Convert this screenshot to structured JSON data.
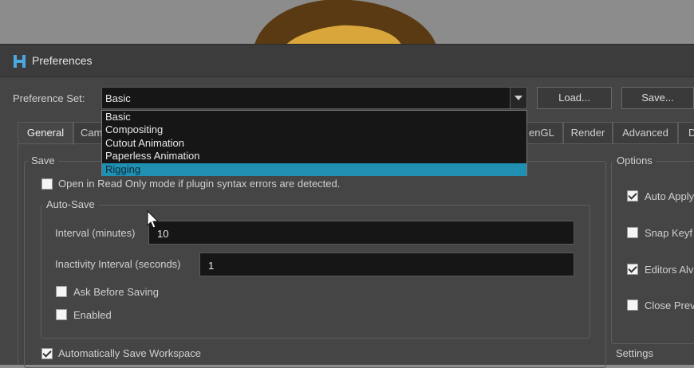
{
  "window": {
    "title": "Preferences"
  },
  "preference_set": {
    "label": "Preference Set:",
    "value": "Basic",
    "options": [
      "Basic",
      "Compositing",
      "Cutout Animation",
      "Paperless Animation",
      "Rigging"
    ],
    "highlighted": "Rigging"
  },
  "buttons": {
    "load": "Load...",
    "save": "Save..."
  },
  "tabs": [
    {
      "label": "General"
    },
    {
      "label": "Cam"
    },
    {
      "label": "enGL"
    },
    {
      "label": "Render"
    },
    {
      "label": "Advanced"
    },
    {
      "label": "D"
    }
  ],
  "save_group": {
    "title": "Save",
    "read_only": {
      "label": "Open in Read Only mode if plugin syntax errors are detected.",
      "checked": false
    },
    "auto_save": {
      "title": "Auto-Save",
      "interval_label": "Interval (minutes)",
      "interval_value": "10",
      "inactivity_label": "Inactivity Interval (seconds)",
      "inactivity_value": "1",
      "ask_before_saving": {
        "label": "Ask Before Saving",
        "checked": false
      },
      "enabled": {
        "label": "Enabled",
        "checked": false
      }
    },
    "auto_save_workspace": {
      "label": "Automatically Save Workspace",
      "checked": true
    }
  },
  "options_group": {
    "title": "Options",
    "items": [
      {
        "label": "Auto Apply",
        "checked": true
      },
      {
        "label": "Snap Keyf",
        "checked": false
      },
      {
        "label": "Editors Alv",
        "checked": true
      },
      {
        "label": "Close Prev",
        "checked": false
      }
    ]
  },
  "settings_group": {
    "title": "Settings"
  },
  "colors": {
    "accent": "#1f8fb2",
    "dialog_bg": "#454545",
    "field_bg": "#161616"
  }
}
